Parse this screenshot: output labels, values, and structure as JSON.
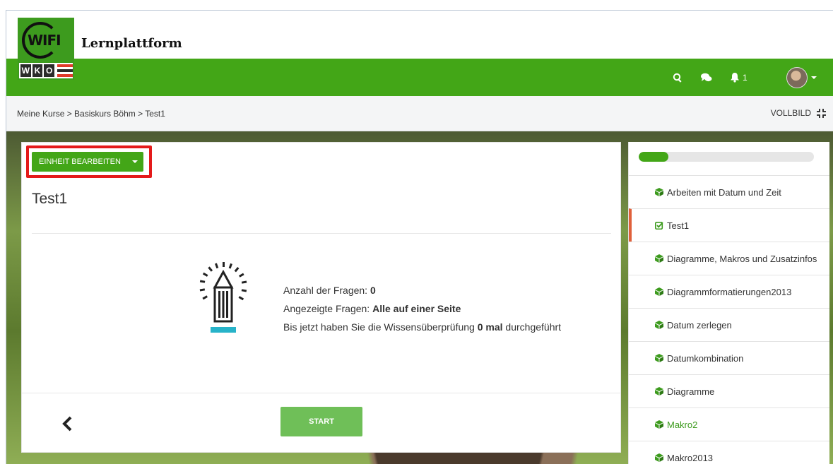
{
  "header": {
    "logo_text": "WIFI",
    "logo_sub": [
      "W",
      "K",
      "O"
    ],
    "app_title": "Lernplattform",
    "notifications_count": "1"
  },
  "breadcrumb": "Meine Kurse > Basiskurs Böhm > Test1",
  "fullscreen_label": "VOLLBILD",
  "unit": {
    "edit_button": "EINHEIT BEARBEITEN",
    "title": "Test1",
    "questions_label": "Anzahl der Fragen: ",
    "questions_value": "0",
    "shown_label": "Angezeigte Fragen: ",
    "shown_value": "Alle auf einer Seite",
    "attempts_prefix": "Bis jetzt haben Sie die Wissensüberprüfung ",
    "attempts_value": "0 mal",
    "attempts_suffix": " durchgeführt",
    "start_button": "START"
  },
  "sidebar": {
    "progress": 0.17,
    "items": [
      {
        "label": "Arbeiten mit Datum und Zeit",
        "icon": "cube-icon"
      },
      {
        "label": "Test1",
        "icon": "check-square-icon",
        "active": true
      },
      {
        "label": "Diagramme, Makros und Zusatzinfos",
        "icon": "cube-icon"
      },
      {
        "label": "Diagrammformatierungen2013",
        "icon": "cube-icon"
      },
      {
        "label": "Datum zerlegen",
        "icon": "cube-icon"
      },
      {
        "label": "Datumkombination",
        "icon": "cube-icon"
      },
      {
        "label": "Diagramme",
        "icon": "cube-icon"
      },
      {
        "label": "Makro2",
        "icon": "cube-icon",
        "green": true
      },
      {
        "label": "Makro2013",
        "icon": "cube-icon"
      }
    ]
  },
  "colors": {
    "brand_green": "#43a617",
    "highlight_red": "#e41a1a",
    "active_marker": "#e0603a"
  }
}
